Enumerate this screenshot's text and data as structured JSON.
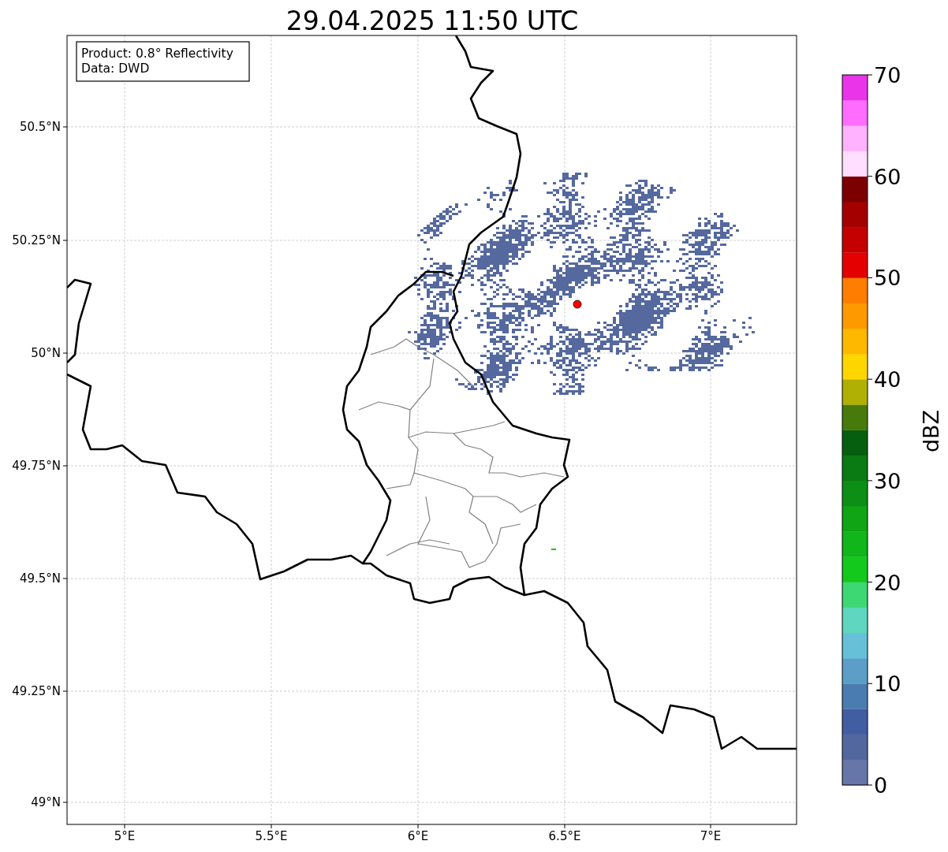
{
  "title": "29.04.2025 11:50 UTC",
  "map": {
    "info_box": [
      "Product: 0.8° Reflectivity",
      "Data: DWD"
    ],
    "lat_ticks": [
      "50.5°N",
      "50.25°N",
      "50°N",
      "49.75°N",
      "49.5°N",
      "49.25°N",
      "49°N"
    ],
    "lon_ticks": [
      "5°E",
      "5.5°E",
      "6°E",
      "6.5°E",
      "7°E"
    ]
  },
  "colorbar": {
    "label": "dBZ",
    "ticks": [
      "70",
      "60",
      "50",
      "40",
      "30",
      "20",
      "10",
      "0"
    ],
    "bins": [
      {
        "color": "#6676a9"
      },
      {
        "color": "#53679f"
      },
      {
        "color": "#425ea2"
      },
      {
        "color": "#4a7cb1"
      },
      {
        "color": "#5b9fc8"
      },
      {
        "color": "#65c0d8"
      },
      {
        "color": "#5fd7c0"
      },
      {
        "color": "#3dd874"
      },
      {
        "color": "#13c91c"
      },
      {
        "color": "#10b61a"
      },
      {
        "color": "#0fa514"
      },
      {
        "color": "#0b9015"
      },
      {
        "color": "#0a7a12"
      },
      {
        "color": "#065f0e"
      },
      {
        "color": "#487a0b"
      },
      {
        "color": "#b0b004"
      },
      {
        "color": "#ffd600"
      },
      {
        "color": "#ffb800"
      },
      {
        "color": "#ff9900"
      },
      {
        "color": "#ff7d00"
      },
      {
        "color": "#e40000"
      },
      {
        "color": "#c50000"
      },
      {
        "color": "#a40000"
      },
      {
        "color": "#7c0000"
      },
      {
        "color": "#ffdeff"
      },
      {
        "color": "#ffb2ff"
      },
      {
        "color": "#ff6cff"
      },
      {
        "color": "#ea34ea"
      }
    ]
  }
}
